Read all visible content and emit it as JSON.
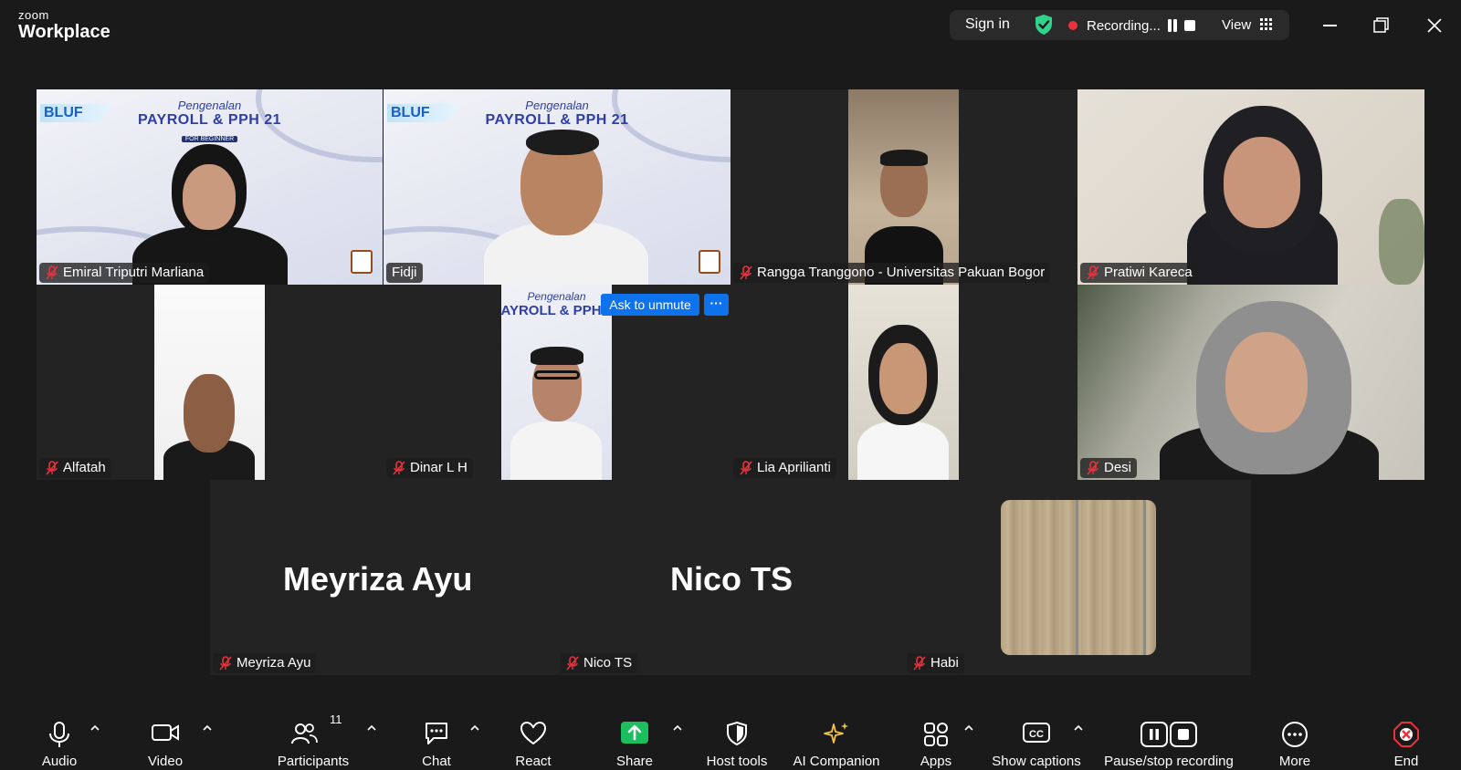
{
  "titlebar": {
    "logo_small": "zoom",
    "logo_big": "Workplace",
    "sign_in": "Sign in",
    "recording": "Recording...",
    "view": "View",
    "colors": {
      "shield": "#2fd38a",
      "record": "#e8323c"
    }
  },
  "slide": {
    "brand": "BLUF",
    "line1": "Pengenalan",
    "line2": "PAYROLL & PPH 21",
    "line3": "FOR BEGINNER"
  },
  "participants": [
    {
      "name": "Emiral Triputri Marliana"
    },
    {
      "name": "Fidji"
    },
    {
      "name": "Rangga Tranggono - Universitas Pakuan Bogor"
    },
    {
      "name": "Pratiwi Kareca"
    },
    {
      "name": "Alfatah"
    },
    {
      "name": "Dinar L H"
    },
    {
      "name": "Lia Aprilianti"
    },
    {
      "name": "Desi"
    },
    {
      "name": "Meyriza Ayu",
      "display": "Meyriza Ayu"
    },
    {
      "name": "Nico TS",
      "display": "Nico TS"
    },
    {
      "name": "Habi"
    }
  ],
  "ask_unmute": {
    "label": "Ask to unmute",
    "more": "···"
  },
  "toolbar": {
    "audio": "Audio",
    "video": "Video",
    "participants": "Participants",
    "participants_count": "11",
    "chat": "Chat",
    "react": "React",
    "share": "Share",
    "host_tools": "Host tools",
    "ai_companion": "AI Companion",
    "apps": "Apps",
    "show_captions": "Show captions",
    "pause_stop_recording": "Pause/stop recording",
    "more": "More",
    "end": "End",
    "colors": {
      "share": "#1bbf5e",
      "ai": "#f5c24a",
      "end": "#e8323c",
      "active_border": "#2fd38a",
      "unmute_btn": "#0e72ed"
    }
  }
}
